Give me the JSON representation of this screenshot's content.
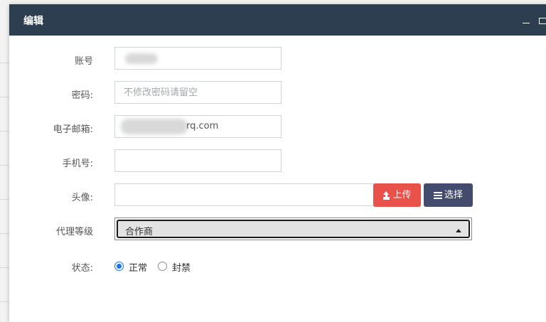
{
  "dialog": {
    "title": "编辑",
    "minimize_symbol": "",
    "maximize_symbol": ""
  },
  "form": {
    "account": {
      "label": "账号",
      "value": ""
    },
    "password": {
      "label": "密码:",
      "placeholder": "不修改密码请留空",
      "value": ""
    },
    "email": {
      "label": "电子邮箱:",
      "value": "rq.com"
    },
    "phone": {
      "label": "手机号:",
      "value": ""
    },
    "avatar": {
      "label": "头像:",
      "value": "",
      "upload_label": "上传",
      "choose_label": "选择"
    },
    "agent_level": {
      "label": "代理等级",
      "selected": "合作商"
    },
    "status": {
      "label": "状态:",
      "options": [
        {
          "label": "正常",
          "checked": true
        },
        {
          "label": "封禁",
          "checked": false
        }
      ]
    }
  },
  "colors": {
    "header_bg": "#2c3e50",
    "upload_button": "#e9524a",
    "choose_button": "#444c6d",
    "radio_accent": "#1a73e8"
  },
  "icons": {
    "upload": "upload-icon",
    "choose": "list-icon",
    "minimize": "minimize-icon",
    "maximize": "maximize-icon",
    "dropdown": "caret-up-icon"
  }
}
